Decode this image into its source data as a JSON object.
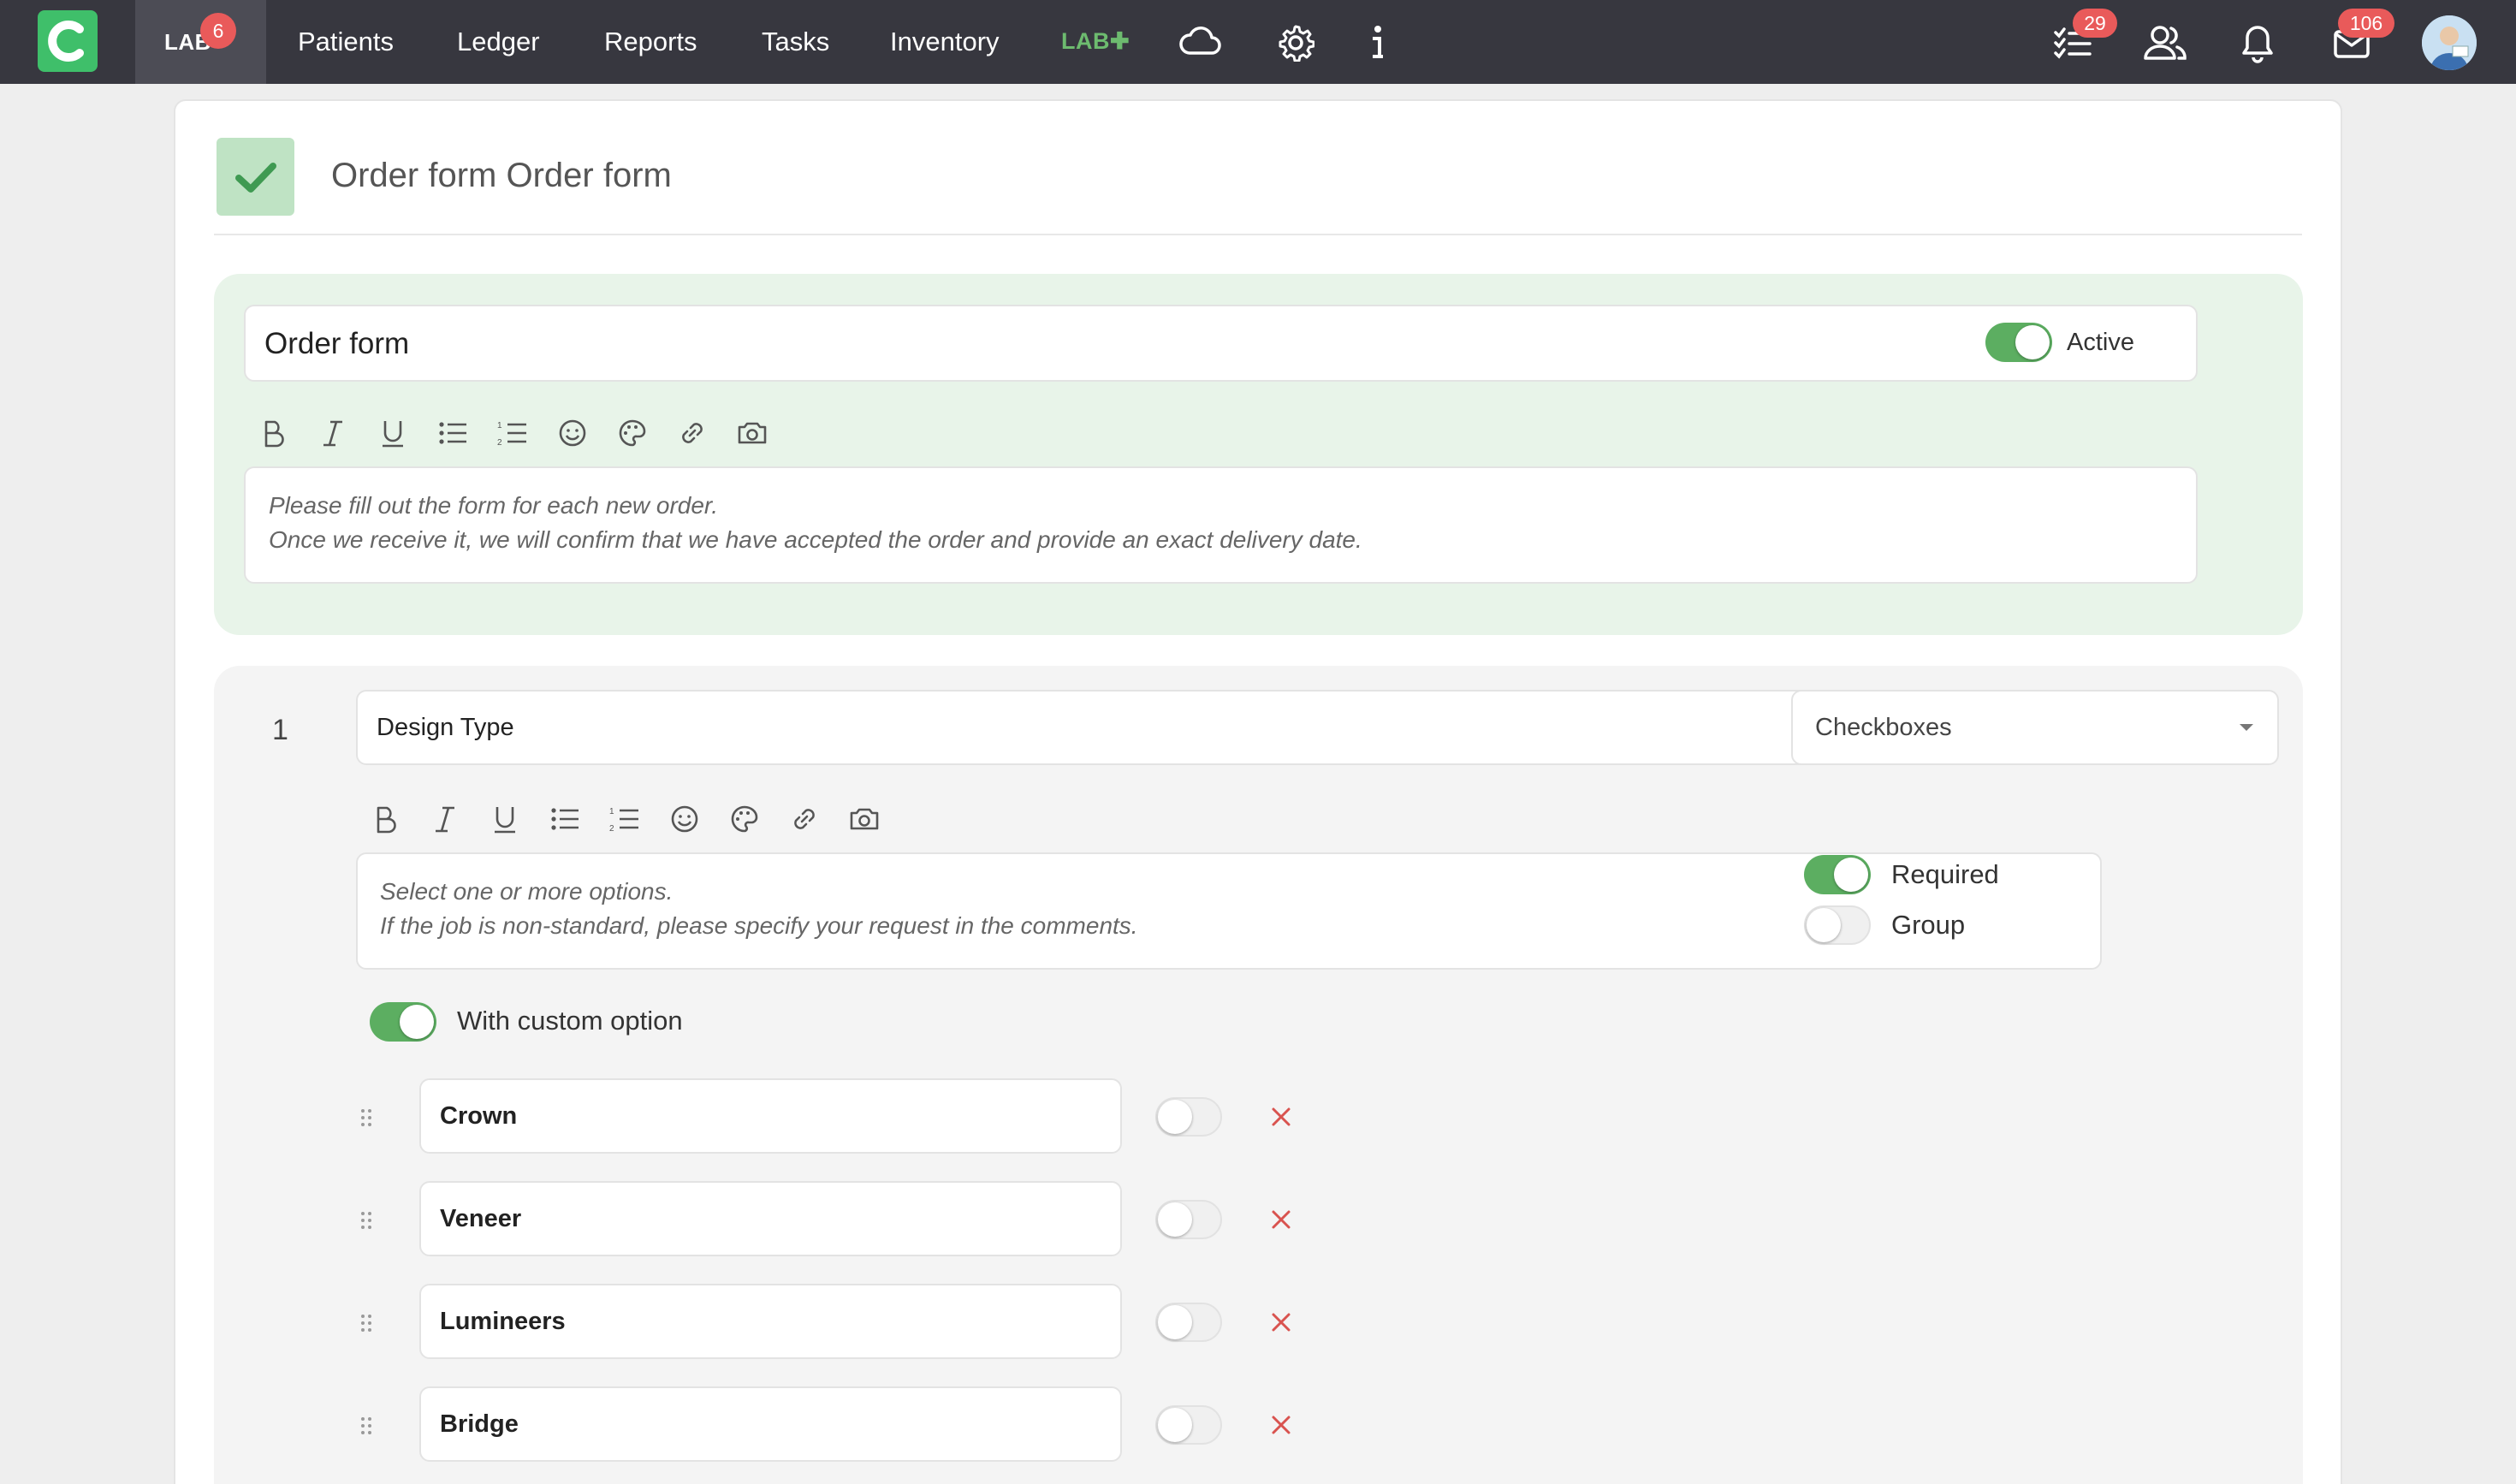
{
  "nav": {
    "lab_label": "LAB",
    "lab_badge": "6",
    "items": [
      "Patients",
      "Ledger",
      "Reports",
      "Tasks",
      "Inventory"
    ],
    "lab_plus": "LAB✚",
    "tasks_badge": "29",
    "messages_badge": "106",
    "icons": [
      "cloud-icon",
      "gear-icon",
      "info-icon",
      "task-list-icon",
      "users-icon",
      "bell-icon",
      "mail-icon"
    ]
  },
  "page": {
    "title": "Order form Order form"
  },
  "form": {
    "name_value": "Order form",
    "active_label": "Active",
    "active": true,
    "description_line1": "Please fill out the form for each new order.",
    "description_line2": "Once we receive it, we will confirm that we have accepted the order and provide an exact delivery date."
  },
  "question": {
    "number": "1",
    "title_value": "Design Type",
    "type_value": "Checkboxes",
    "description_line1": "Select one or more options.",
    "description_line2": "If the job is non-standard, please specify your request in the comments.",
    "required_label": "Required",
    "required": true,
    "group_label": "Group",
    "group": false,
    "custom_option_label": "With custom option",
    "custom_option": true,
    "options": [
      {
        "label": "Crown",
        "enabled": false
      },
      {
        "label": "Veneer",
        "enabled": false
      },
      {
        "label": "Lumineers",
        "enabled": false
      },
      {
        "label": "Bridge",
        "enabled": false
      }
    ]
  },
  "colors": {
    "topbar": "#37373f",
    "accent_green": "#5cae61",
    "badge_red": "#e95a5a",
    "delete_red": "#d9534f"
  }
}
